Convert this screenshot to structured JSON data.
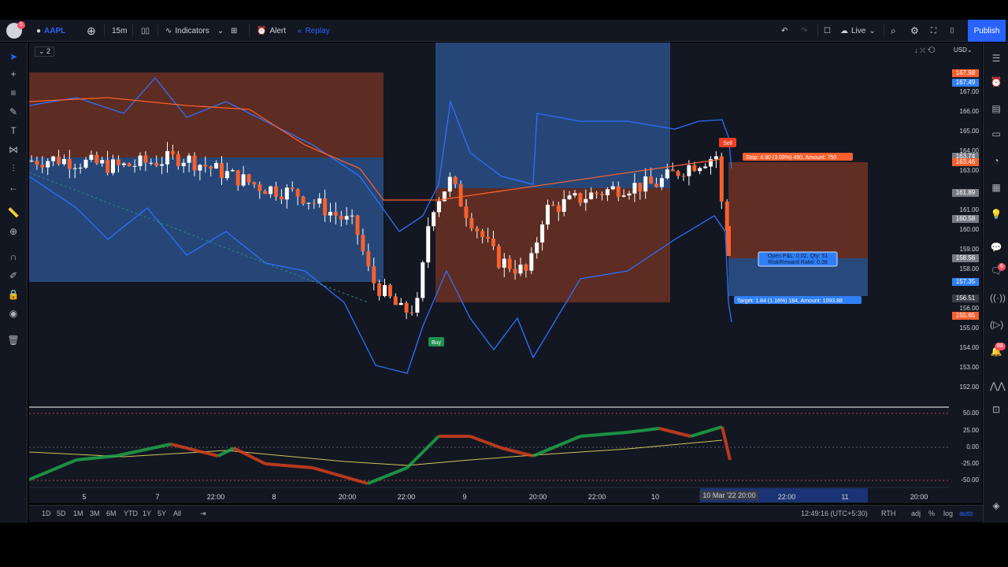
{
  "toolbar": {
    "symbol": "AAPL",
    "interval": "15m",
    "indicators": "Indicators",
    "alert": "Alert",
    "replay": "Replay",
    "live": "Live",
    "publish": "Publish",
    "avatar_badge": "5"
  },
  "chart": {
    "layout_count": "2",
    "currency": "USD",
    "price_ticks": [
      "167.00",
      "166.00",
      "165.00",
      "164.00",
      "163.00",
      "161.00",
      "160.00",
      "159.00",
      "158.00",
      "156.00",
      "155.00",
      "154.00",
      "153.00",
      "152.00"
    ],
    "price_tags": [
      {
        "label": "167.98",
        "price": 167.98,
        "color": "#f7602e"
      },
      {
        "label": "167.49",
        "price": 167.49,
        "color": "#2f7ff7"
      },
      {
        "label": "163.74",
        "price": 163.74,
        "color": "#787b86"
      },
      {
        "label": "163.46",
        "price": 163.46,
        "color": "#f7602e"
      },
      {
        "label": "161.89",
        "price": 161.89,
        "color": "#787b86"
      },
      {
        "label": "160.58",
        "price": 160.58,
        "color": "#787b86"
      },
      {
        "label": "158.56",
        "price": 158.56,
        "color": "#787b86"
      },
      {
        "label": "157.35",
        "price": 157.35,
        "color": "#2f7ff7"
      },
      {
        "label": "156.51",
        "price": 156.51,
        "color": "#3a3e49"
      },
      {
        "label": "155.65",
        "price": 155.65,
        "color": "#f7602e"
      }
    ],
    "sell_label": "Sell",
    "buy_label": "Buy",
    "stop_label": "Stop: 4.90 (3.09%) 490, Amount: 750",
    "pnl_label": "Open P&L: 0.02, Qty: 51",
    "rr_label": "Risk/Reward Ratio: 0.38",
    "target_label": "Target: 1.84 (1.16%) 184, Amount: 1093.88",
    "osc_ticks": [
      "50.00",
      "25.00",
      "0.00",
      "-25.00",
      "-50.00"
    ],
    "time_labels": [
      "5",
      "7",
      "22:00",
      "8",
      "20:00",
      "22:00",
      "9",
      "20:00",
      "22:00",
      "10",
      "22:00",
      "11",
      "20:00"
    ],
    "crosshair_time": "10 Mar '22  20:00"
  },
  "bottom": {
    "ranges": [
      "1D",
      "5D",
      "1M",
      "3M",
      "6M",
      "YTD",
      "1Y",
      "5Y",
      "All"
    ],
    "clock": "12:49:16 (UTC+5:30)",
    "session": "RTH",
    "adj": "adj",
    "percent": "%",
    "log": "log",
    "auto": "auto"
  },
  "sidebar": {
    "chat_badge": "6",
    "alerts_badge": "88"
  },
  "colors": {
    "accent": "#2962ff",
    "up": "#26a69a",
    "down": "#f7602e"
  }
}
